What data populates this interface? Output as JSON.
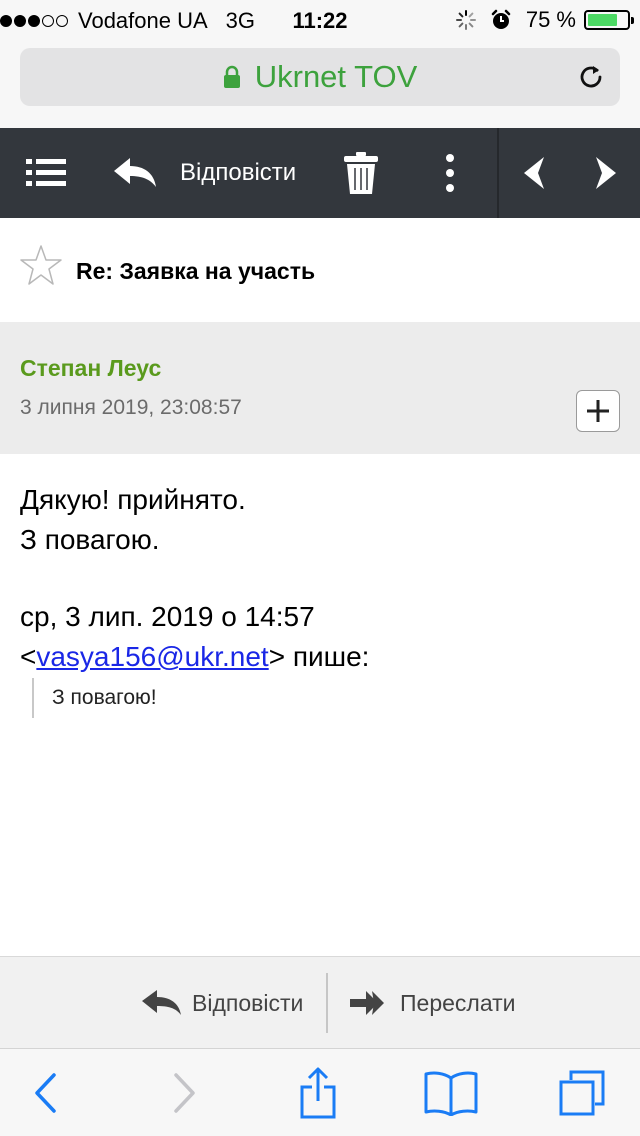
{
  "status_bar": {
    "signal_bars": 3,
    "signal_total": 5,
    "carrier": "Vodafone UA",
    "network": "3G",
    "time": "11:22",
    "battery_text": "75 %",
    "battery_level": 0.75
  },
  "address_bar": {
    "site_name": "Ukrnet TOV",
    "secure_color": "#3da23d"
  },
  "toolbar": {
    "reply_label": "Відповісти"
  },
  "message": {
    "subject": "Re: Заявка на участь",
    "sender_name": "Степан Леус",
    "sender_date": "3 липня 2019, 23:08:57",
    "body_line1": "Дякую! прийнято.",
    "body_line2": "З повагою.",
    "quote_header_line1": "ср, 3 лип. 2019 о 14:57",
    "quote_open": "<",
    "quote_email": "vasya156@ukr.net",
    "quote_close": "> пише:",
    "quoted_text": "З повагою!"
  },
  "reply_bar": {
    "reply_label": "Відповісти",
    "forward_label": "Переслати"
  },
  "colors": {
    "toolbar_bg": "#33373d",
    "sender_name": "#5a9a1d",
    "link": "#1a27e6",
    "ios_blue": "#1a7cf5"
  },
  "icons": {
    "toolbar": [
      "menu-icon",
      "reply-icon",
      "trash-icon",
      "more-vertical-icon",
      "prev-message-icon",
      "next-message-icon"
    ],
    "reply_bar": [
      "reply-icon",
      "forward-icon"
    ],
    "safari": [
      "back-icon",
      "forward-icon",
      "share-icon",
      "bookmarks-icon",
      "tabs-icon"
    ]
  }
}
